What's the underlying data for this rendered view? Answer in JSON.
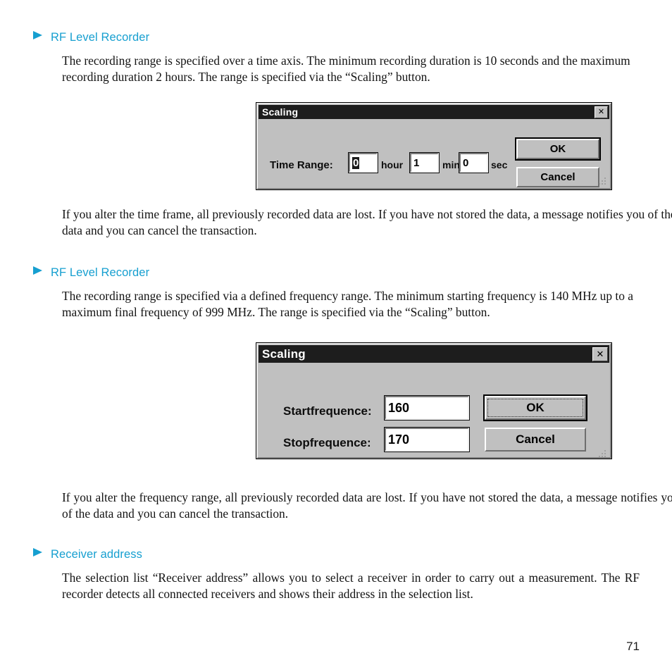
{
  "page": {
    "number": "71"
  },
  "sections": [
    {
      "heading": "RF Level Recorder",
      "bullet_icon": "triangle-right-icon",
      "paragraph": "The recording range is specified over a time axis. The minimum recording duration is 10 seconds and the maximum recording duration 2 hours. The range is specified via the “Scaling” button.",
      "after_paragraph": "If you alter the time frame, all previously recorded data are lost. If you have not stored the data, a message notifies you of the loss of the data and you can cancel the transaction."
    },
    {
      "heading": "RF Level Recorder",
      "bullet_icon": "triangle-right-icon",
      "paragraph": "The recording range is specified via a defined frequency range. The minimum starting frequency is 140 MHz up to a maximum final frequency of 999 MHz. The range is specified via the “Scaling” button.",
      "after_paragraph": "If you alter the frequency range, all previously recorded data are lost. If you have not stored the data, a message notifies you of the loss of the data and you can cancel the transaction."
    },
    {
      "heading": "Receiver address",
      "bullet_icon": "triangle-right-icon",
      "paragraph": "The selection list “Receiver address” allows you to select a receiver in order to carry out a measurement. The RF recorder detects all connected receivers and shows their address in the selection list.",
      "after_paragraph": ""
    }
  ],
  "dialog_time": {
    "title": "Scaling",
    "close_label": "✕",
    "label": "Time Range:",
    "fields": [
      {
        "value": "0",
        "unit": "hour",
        "selected": true
      },
      {
        "value": "1",
        "unit": "min",
        "selected": false
      },
      {
        "value": "0",
        "unit": "sec",
        "selected": false
      }
    ],
    "ok_label": "OK",
    "cancel_label": "Cancel"
  },
  "dialog_freq": {
    "title": "Scaling",
    "close_label": "✕",
    "rows": [
      {
        "label": "Startfrequence:",
        "value": "160"
      },
      {
        "label": "Stopfrequence:",
        "value": "170"
      }
    ],
    "ok_label": "OK",
    "cancel_label": "Cancel"
  },
  "colors": {
    "heading": "#169FD0",
    "dialog_face": "#C0C0C0",
    "titlebar": "#1D1D1D",
    "body_text": "#131313"
  }
}
